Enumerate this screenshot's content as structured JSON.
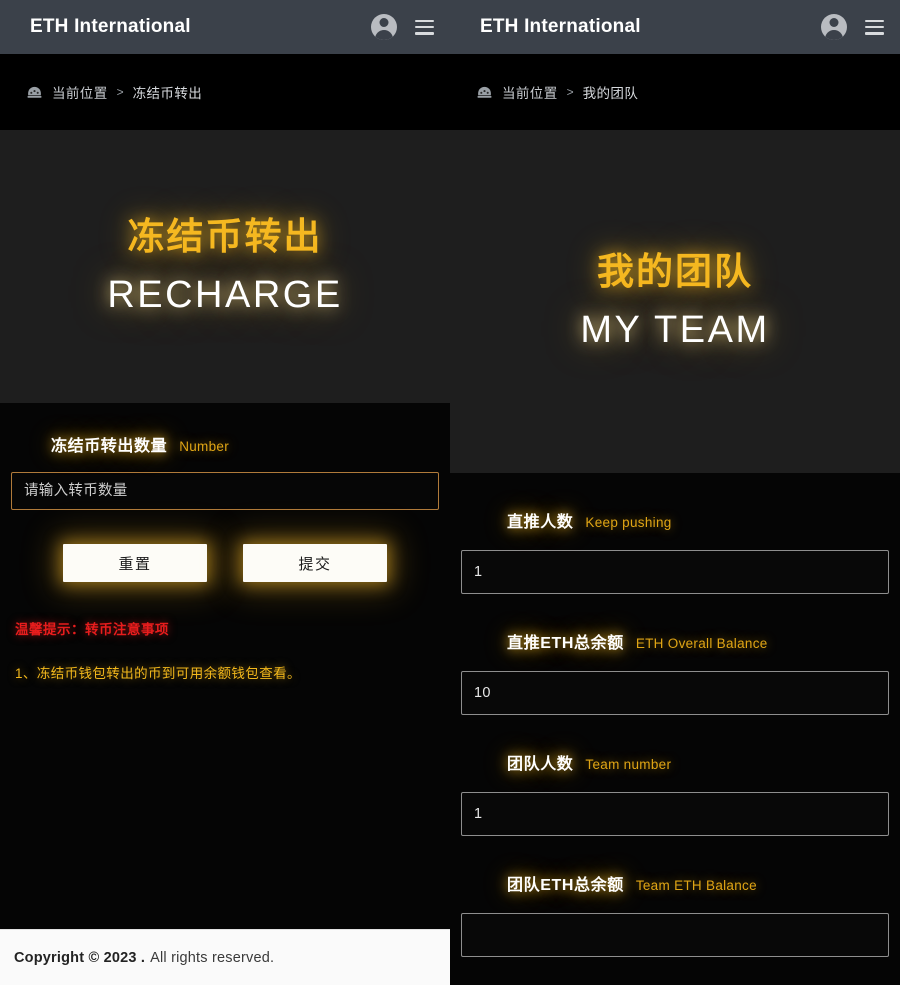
{
  "header": {
    "brand": "ETH International",
    "avatar_icon": "user-avatar-icon",
    "menu_icon": "hamburger-menu-icon"
  },
  "left": {
    "breadcrumb": {
      "icon": "dashboard-speedometer-icon",
      "root": "当前位置",
      "separator": ">",
      "current": "冻结币转出"
    },
    "hero": {
      "title_cn": "冻结币转出",
      "title_en": "RECHARGE"
    },
    "form": {
      "label_cn": "冻结币转出数量",
      "label_en": "Number",
      "input_value": "",
      "input_placeholder": "请输入转币数量",
      "reset_label": "重置",
      "submit_label": "提交"
    },
    "notice": {
      "title": "温馨提示：转币注意事项",
      "line1": "1、冻结币钱包转出的币到可用余额钱包查看。"
    },
    "footer": {
      "copyright": "Copyright © 2023 .",
      "rights": "All rights reserved."
    }
  },
  "right": {
    "breadcrumb": {
      "icon": "dashboard-speedometer-icon",
      "root": "当前位置",
      "separator": ">",
      "current": "我的团队"
    },
    "hero": {
      "title_cn": "我的团队",
      "title_en": "MY TEAM"
    },
    "fields": [
      {
        "label_cn": "直推人数",
        "label_en": "Keep pushing",
        "value": "1"
      },
      {
        "label_cn": "直推ETH总余额",
        "label_en": "ETH Overall Balance",
        "value": "10"
      },
      {
        "label_cn": "团队人数",
        "label_en": "Team number",
        "value": "1"
      },
      {
        "label_cn": "团队ETH总余额",
        "label_en": "Team ETH Balance",
        "value": ""
      }
    ]
  },
  "colors": {
    "accent_gold": "#f5b820",
    "accent_gold_dim": "#e0a515",
    "header_bg": "#3b414a",
    "hero_bg": "#1e1e1e",
    "page_bg": "#050505",
    "warning_red": "#e81d1d",
    "input_border_left": "#b07a3a",
    "input_border_right": "#8e8e8e",
    "footer_bg": "#fafafa"
  }
}
